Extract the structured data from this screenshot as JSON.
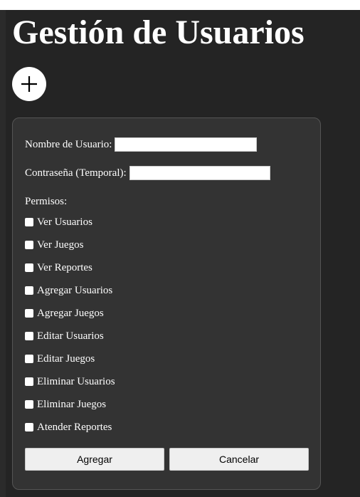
{
  "page": {
    "title": "Gestión de Usuarios",
    "add_button_icon": "plus-icon"
  },
  "form": {
    "username_label": "Nombre de Usuario:",
    "username_value": "",
    "password_label": "Contraseña (Temporal):",
    "password_value": "",
    "permissions_label": "Permisos:",
    "permissions": [
      {
        "label": "Ver Usuarios",
        "checked": false
      },
      {
        "label": "Ver Juegos",
        "checked": false
      },
      {
        "label": "Ver Reportes",
        "checked": false
      },
      {
        "label": "Agregar Usuarios",
        "checked": false
      },
      {
        "label": "Agregar Juegos",
        "checked": false
      },
      {
        "label": "Editar Usuarios",
        "checked": false
      },
      {
        "label": "Editar Juegos",
        "checked": false
      },
      {
        "label": "Eliminar Usuarios",
        "checked": false
      },
      {
        "label": "Eliminar Juegos",
        "checked": false
      },
      {
        "label": "Atender Reportes",
        "checked": false
      }
    ],
    "add_button_label": "Agregar",
    "cancel_button_label": "Cancelar"
  },
  "colors": {
    "page_background": "#242424",
    "panel_background": "#333333",
    "text": "#ffffff",
    "button_background": "#efefef"
  }
}
